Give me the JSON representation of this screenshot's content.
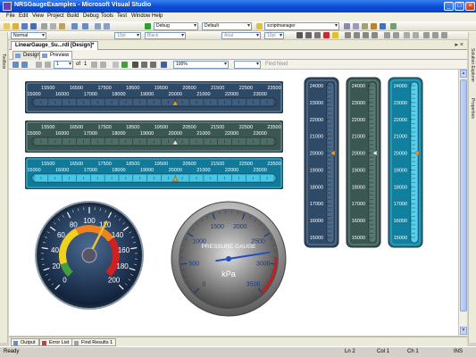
{
  "window": {
    "title": "NRSGaugeExamples - Microsoft Visual Studio",
    "buttons": [
      "_",
      "□",
      "×"
    ]
  },
  "menu": [
    "File",
    "Edit",
    "View",
    "Project",
    "Build",
    "Debug",
    "Tools",
    "Test",
    "Window",
    "Help"
  ],
  "toolbar1": {
    "config": "Debug",
    "platform": "Default",
    "find": "scriptmanager"
  },
  "toolbar2": {
    "style": "Normal",
    "font": "Arial",
    "size": "10pt",
    "color": "Black",
    "size_label": "10pt"
  },
  "document_tab": {
    "label": "LinearGauge_Su...rdl [Design]*"
  },
  "view_tabs": [
    "Design",
    "Preview"
  ],
  "report_toolbar": {
    "page": "1",
    "of": "of",
    "total": "1",
    "zoom": "100%",
    "find": "Find",
    "next": "Next"
  },
  "side_left": [
    "Toolbox"
  ],
  "side_right": [
    "Solution Explorer",
    "Properties"
  ],
  "linear_gauges": {
    "top_ticks": [
      "15500",
      "16500",
      "17500",
      "18500",
      "19500",
      "20500",
      "21500",
      "22500",
      "23500"
    ],
    "bottom_ticks": [
      "15000",
      "16000",
      "17000",
      "18000",
      "19000",
      "20000",
      "21000",
      "22000",
      "23000"
    ],
    "value": 20000,
    "range": [
      15000,
      23500
    ],
    "styles": [
      {
        "bg": "#2f4a66",
        "scale": "#3f5d7d",
        "pointer": "#f0a030"
      },
      {
        "bg": "#3a5752",
        "scale": "#4e6d67",
        "pointer": "#e8e8e8"
      },
      {
        "bg": "#0f7a9a",
        "scale": "#48c6e6",
        "pointer": "#f0a030"
      }
    ]
  },
  "vertical_gauges": {
    "ticks": [
      "24000",
      "23000",
      "22000",
      "21000",
      "20000",
      "19000",
      "18000",
      "17000",
      "16000",
      "15000"
    ],
    "value": 20000,
    "range": [
      15000,
      24000
    ],
    "styles": [
      {
        "bg": "#2f4a66",
        "scale": "#4a6987",
        "pointer": "#f0a030"
      },
      {
        "bg": "#3a5752",
        "scale": "#587872",
        "pointer": "#e8e8e8"
      },
      {
        "bg": "#11809e",
        "scale": "#55d0ee",
        "pointer": "#f0a030"
      }
    ]
  },
  "speedometer": {
    "ticks": [
      "0",
      "20",
      "40",
      "60",
      "80",
      "100",
      "120",
      "140",
      "160",
      "180",
      "200"
    ],
    "value": 120,
    "max": 200
  },
  "pressure_gauge": {
    "label": "PRESSURE GAUGE",
    "unit": "kPa",
    "ticks": [
      "0",
      "500",
      "1000",
      "1500",
      "2000",
      "2500",
      "3000",
      "3500"
    ],
    "value": 2800,
    "max": 3500
  },
  "bottom_tabs": [
    "Output",
    "Error List",
    "Find Results 1"
  ],
  "status": {
    "ready": "Ready",
    "ln": "Ln 2",
    "col": "Col 1",
    "ch": "Ch 1",
    "ins": "INS"
  }
}
